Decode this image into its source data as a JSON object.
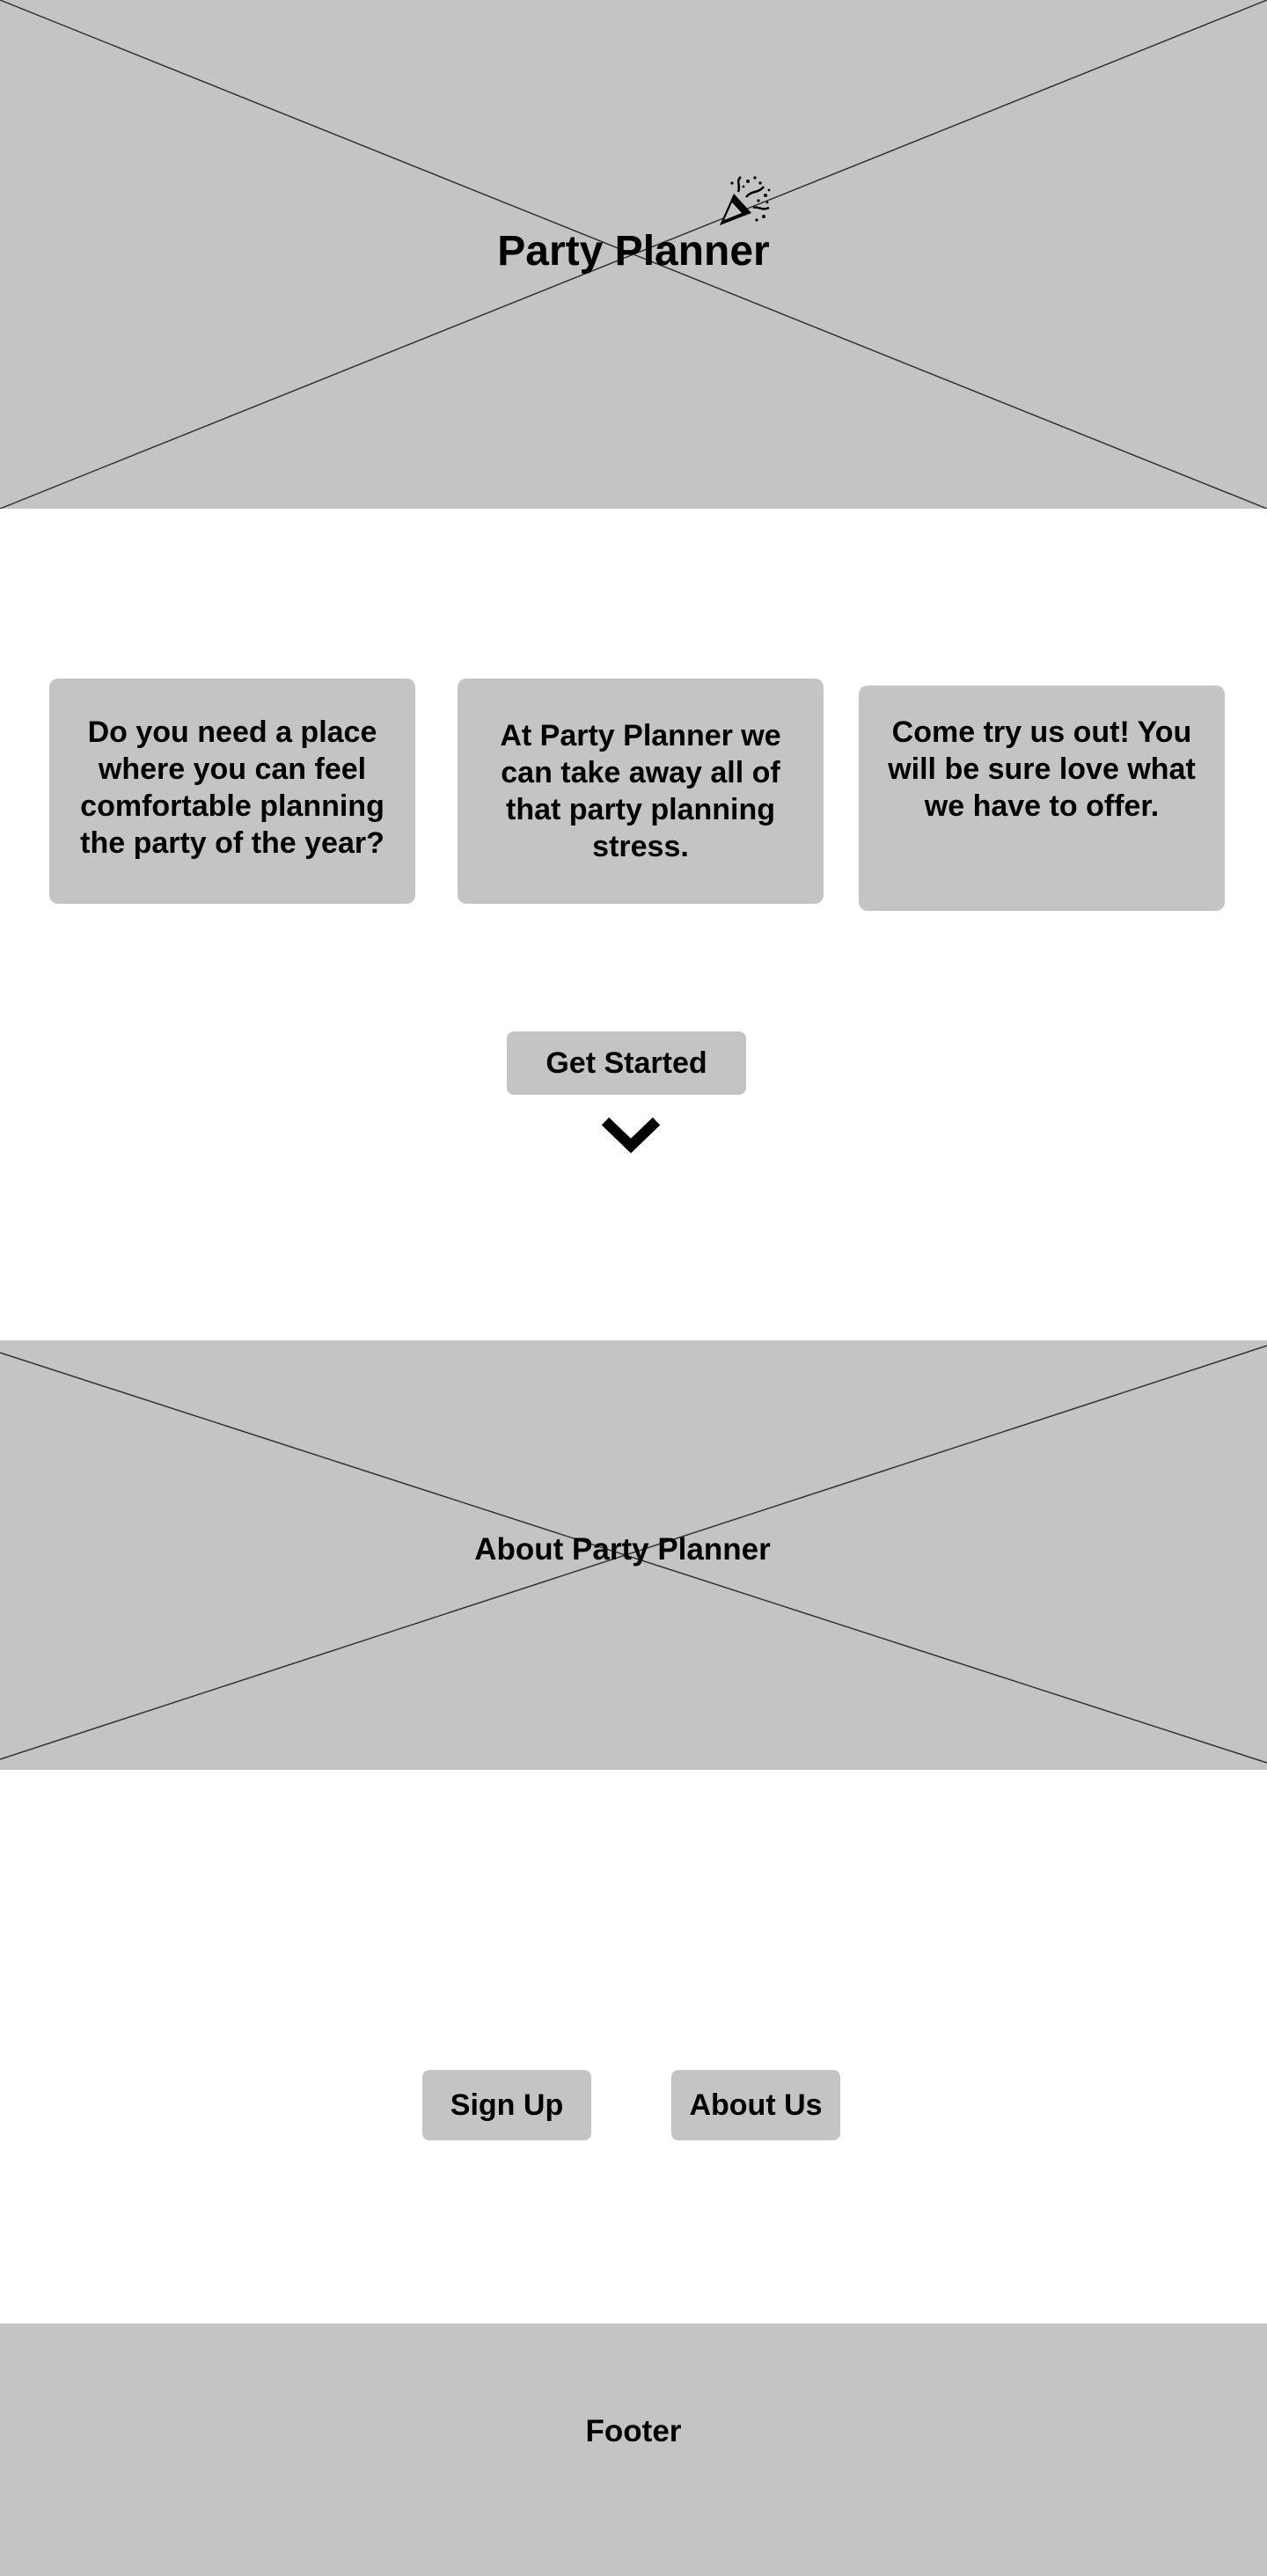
{
  "hero": {
    "title": "Party Planner",
    "icon": "party-popper-icon"
  },
  "features": {
    "cards": [
      {
        "text": "Do  you need a place where you can feel comfortable planning the party of the year?"
      },
      {
        "text": "At Party Planner we can take away all of that party planning stress."
      },
      {
        "text": "Come try us out! You will be sure love what we have to offer."
      }
    ]
  },
  "cta": {
    "get_started_label": "Get Started",
    "scroll_icon": "chevron-down-icon"
  },
  "about": {
    "title": "About Party Planner"
  },
  "actions": {
    "sign_up_label": "Sign Up",
    "about_us_label": "About Us"
  },
  "footer": {
    "text": "Footer"
  },
  "colors": {
    "placeholder": "#c4c4c4",
    "background": "#ffffff",
    "text": "#000000"
  }
}
